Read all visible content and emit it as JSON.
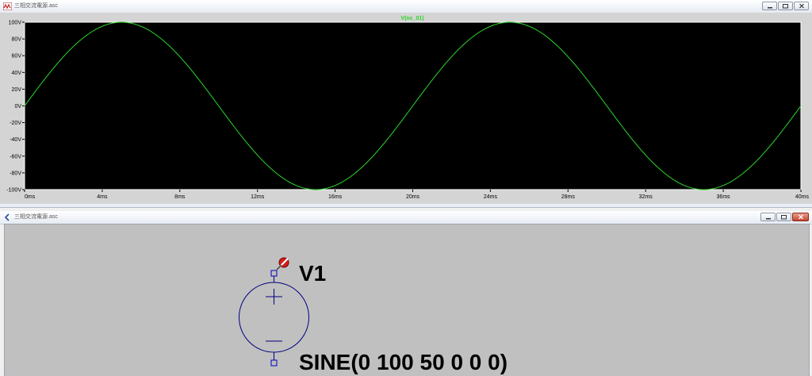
{
  "plot_window": {
    "title": "三相交流電源.asc",
    "trace_label": "V(nc_01)",
    "trace_color": "#2ad62a"
  },
  "schematic_window": {
    "title": "三相交流電源.asc",
    "component_name": "V1",
    "component_value": "SINE(0 100 50 0 0 0)",
    "wire_color": "#000080"
  },
  "window_controls": [
    "minimize",
    "restore",
    "close"
  ],
  "chart_data": {
    "type": "line",
    "series": [
      {
        "name": "V(nc_01)",
        "function": "sine",
        "offset": 0,
        "amplitude": 100,
        "frequency_hz": 50,
        "x_range": [
          0,
          40
        ],
        "color": "#2ad62a"
      }
    ],
    "xlim": [
      0,
      40
    ],
    "ylim": [
      -100,
      100
    ],
    "xticks": [
      0,
      4,
      8,
      12,
      16,
      20,
      24,
      28,
      32,
      36,
      40
    ],
    "yticks": [
      100,
      80,
      60,
      40,
      20,
      0,
      -20,
      -40,
      -60,
      -80,
      -100
    ],
    "x_tick_labels": [
      "0ms",
      "4ms",
      "8ms",
      "12ms",
      "16ms",
      "20ms",
      "24ms",
      "28ms",
      "32ms",
      "36ms",
      "40ms"
    ],
    "y_tick_labels": [
      "100V",
      "80V",
      "60V",
      "40V",
      "20V",
      "0V",
      "-20V",
      "-40V",
      "-60V",
      "-80V",
      "-100V"
    ],
    "grid": false,
    "background": "#000000"
  }
}
